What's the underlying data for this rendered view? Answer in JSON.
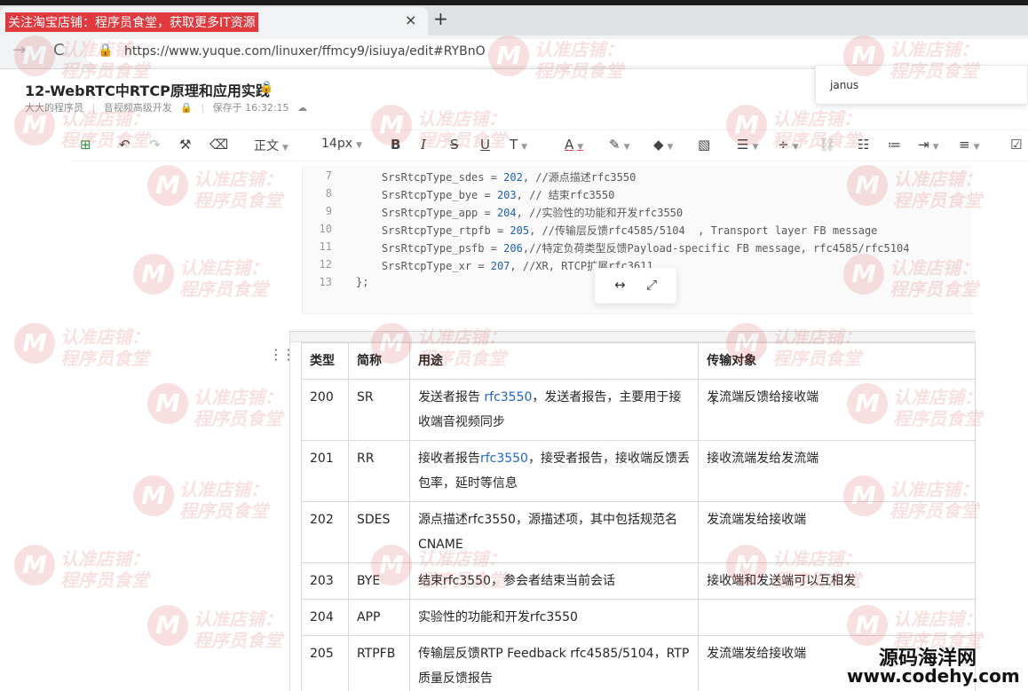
{
  "browser": {
    "tab_title": "关注淘宝店铺：程序员食堂，获取更多IT资源",
    "tab_close": "×",
    "new_tab": "+",
    "back": "→",
    "reload": "C",
    "url": "https://www.yuque.com/linuxer/ffmcy9/isiuya/edit#RYBnO"
  },
  "doc": {
    "title": "12-WebRTC中RTCP原理和应用实践",
    "author": "大大的程序员",
    "book": "音视频高级开发",
    "saved": "保存于 16:32:15"
  },
  "search_popup": {
    "text": "janus"
  },
  "toolbar": {
    "style": "正文",
    "font_size": "14px"
  },
  "code": {
    "lines": [
      {
        "n": "7",
        "pre": "    SrsRtcpType_sdes = ",
        "num": "202",
        "post": ", //源点描述rfc3550"
      },
      {
        "n": "8",
        "pre": "    SrsRtcpType_bye = ",
        "num": "203",
        "post": ", // 结束rfc3550"
      },
      {
        "n": "9",
        "pre": "    SrsRtcpType_app = ",
        "num": "204",
        "post": ", //实验性的功能和开发rfc3550"
      },
      {
        "n": "10",
        "pre": "    SrsRtcpType_rtpfb = ",
        "num": "205",
        "post": ", //传输层反馈rfc4585/5104  , Transport layer FB message"
      },
      {
        "n": "11",
        "pre": "    SrsRtcpType_psfb = ",
        "num": "206",
        "post": ",//特定负荷类型反馈Payload-specific FB message, rfc4585/rfc5104"
      },
      {
        "n": "12",
        "pre": "    SrsRtcpType_xr = ",
        "num": "207",
        "post": ", //XR, RTCP扩展rfc3611"
      },
      {
        "n": "13",
        "pre": "};",
        "num": "",
        "post": ""
      }
    ]
  },
  "table": {
    "headers": [
      "类型",
      "简称",
      "用途",
      "传输对象"
    ],
    "rows": [
      {
        "type": "200",
        "abbr": "SR",
        "use_pre": "发送者报告 ",
        "use_link": "rfc3550",
        "use_post": "，发送者报告，主要用于接收端音视频同步",
        "target": "发流端反馈给接收端"
      },
      {
        "type": "201",
        "abbr": "RR",
        "use_pre": "接收者报告",
        "use_link": "rfc3550",
        "use_post": "，接受者报告，接收端反馈丢包率，延时等信息",
        "target": "接收流端发给发流端"
      },
      {
        "type": "202",
        "abbr": "SDES",
        "use_pre": "源点描述rfc3550，源描述项，其中包括规范名CNAME",
        "use_link": "",
        "use_post": "",
        "target": "发流端发给接收端"
      },
      {
        "type": "203",
        "abbr": "BYE",
        "use_pre": "结束rfc3550，参会者结束当前会话",
        "use_link": "",
        "use_post": "",
        "target": "接收端和发送端可以互相发"
      },
      {
        "type": "204",
        "abbr": "APP",
        "use_pre": "实验性的功能和开发rfc3550",
        "use_link": "",
        "use_post": "",
        "target": ""
      },
      {
        "type": "205",
        "abbr": "RTPFB",
        "use_pre": "传输层反馈RTP Feedback rfc4585/5104，RTP质量反馈报告",
        "use_link": "",
        "use_post": "",
        "target": "发流端发给接收端"
      }
    ]
  },
  "watermark": {
    "line1": "认准店铺：",
    "line2": "程序员食堂",
    "logo": "M"
  },
  "brand": {
    "name": "源码海洋网",
    "url": "www.codehy.com"
  }
}
